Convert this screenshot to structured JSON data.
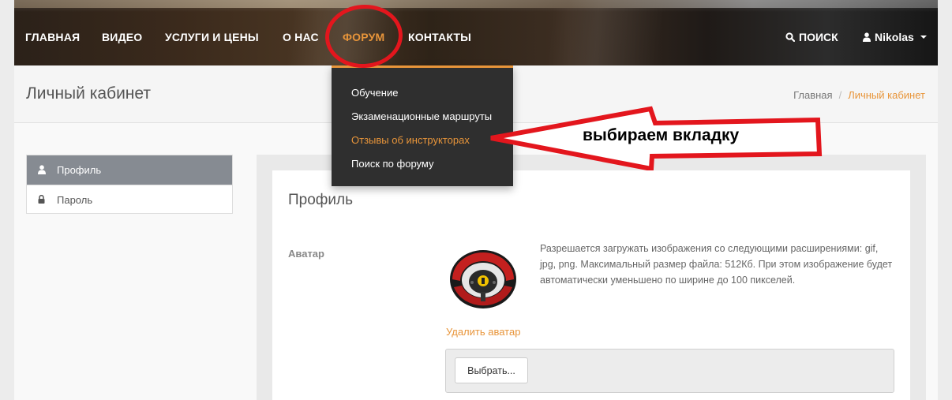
{
  "nav": {
    "items": [
      "ГЛАВНАЯ",
      "ВИДЕО",
      "УСЛУГИ И ЦЕНЫ",
      "О НАС",
      "ФОРУМ",
      "КОНТАКТЫ"
    ],
    "search_label": "ПОИСК",
    "user_label": "Nikolas"
  },
  "forum_menu": {
    "items": [
      "Обучение",
      "Экзаменационные маршруты",
      "Отзывы об инструкторах",
      "Поиск по форуму"
    ],
    "highlighted_index": 2
  },
  "annotation": {
    "text": "выбираем вкладку",
    "color": "#e3161d"
  },
  "page": {
    "title": "Личный кабинет",
    "breadcrumb": [
      "Главная",
      "Личный кабинет"
    ]
  },
  "sidebar": {
    "items": [
      {
        "label": "Профиль",
        "icon": "user-icon",
        "active": true
      },
      {
        "label": "Пароль",
        "icon": "lock-icon",
        "active": false
      }
    ]
  },
  "profile": {
    "title": "Профиль",
    "avatar_label": "Аватар",
    "avatar_image": "steering-wheel-avatar",
    "avatar_help": "Разрешается загружать изображения со следующими расширениями: gif, jpg, png. Максимальный размер файла: 512Кб. При этом изображение будет автоматически уменьшено по ширине до 100 пикселей.",
    "delete_label": "Удалить аватар",
    "choose_label": "Выбрать..."
  },
  "colors": {
    "accent": "#e8953a",
    "dropdown_bg": "#2f2f2f",
    "sidebar_active": "#868b92"
  }
}
